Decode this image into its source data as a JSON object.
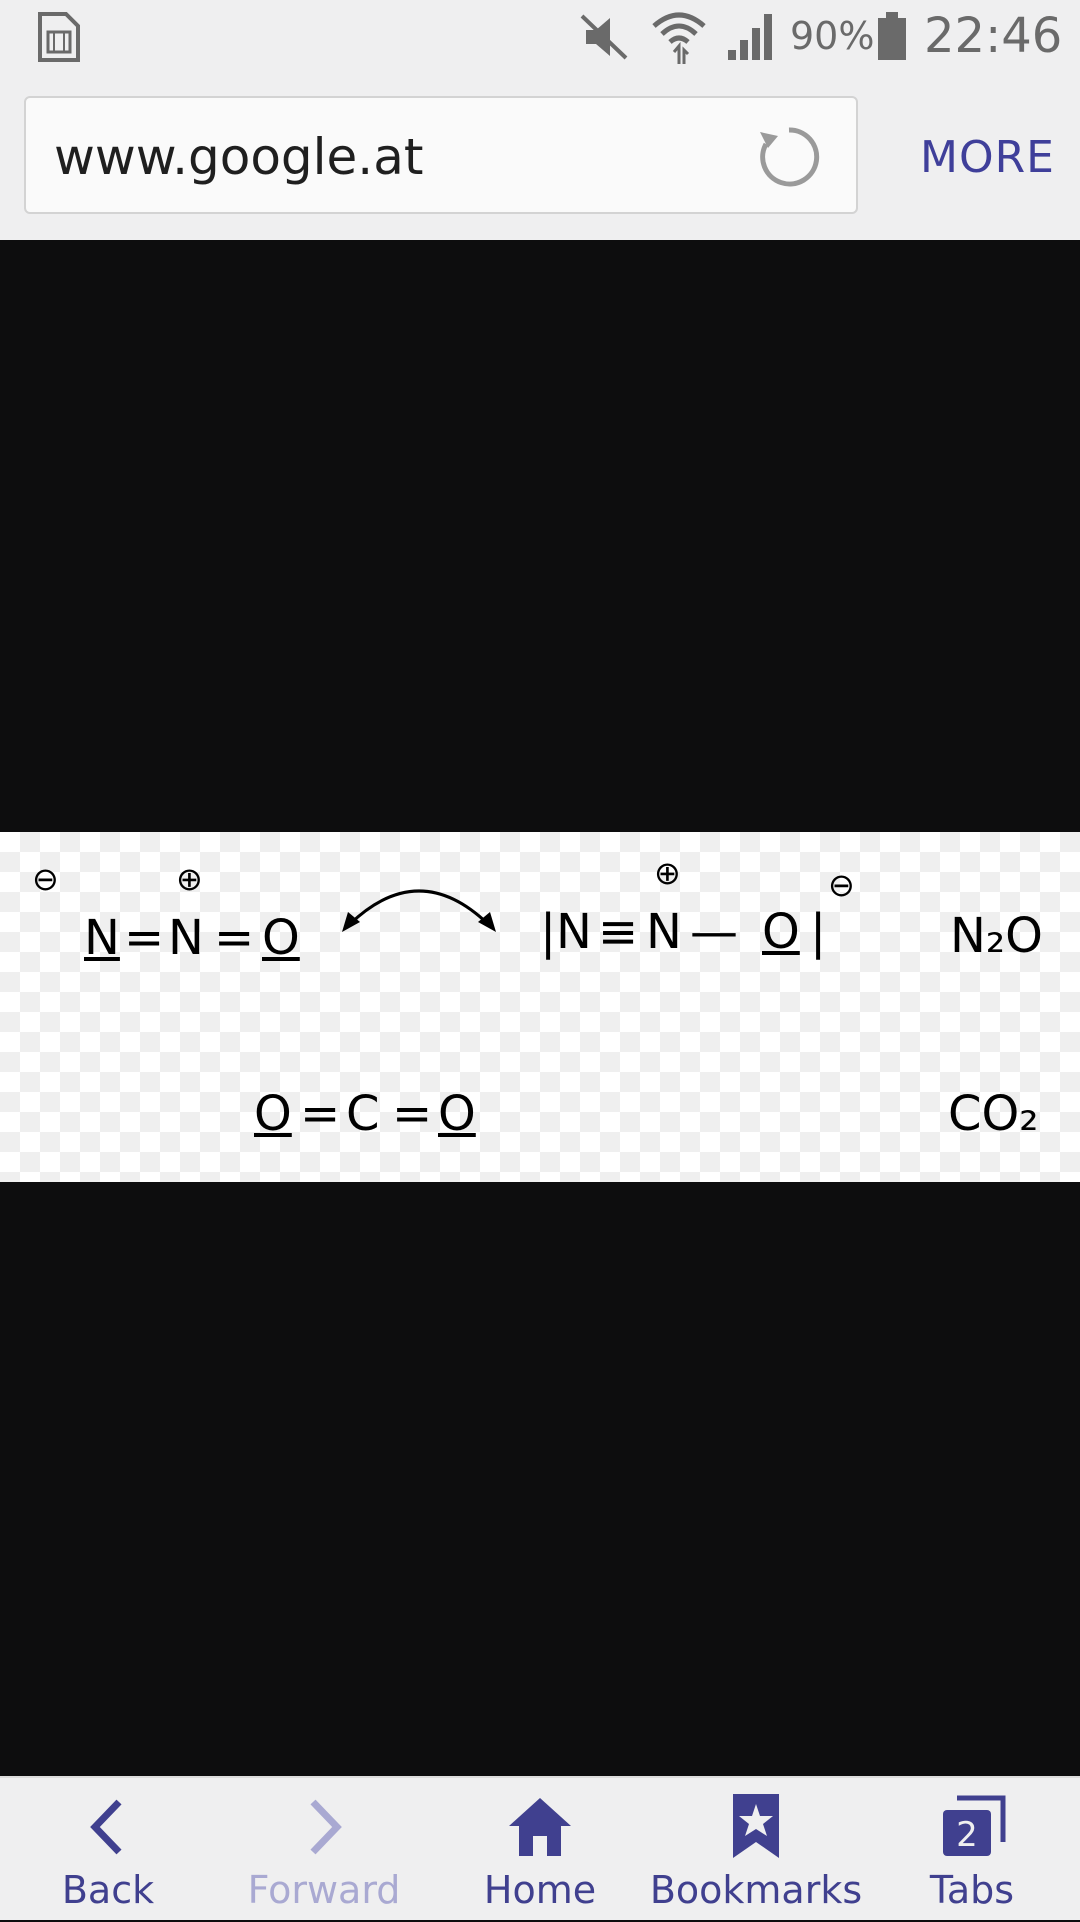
{
  "status_bar": {
    "battery_percent": "90%",
    "time": "22:46",
    "icons": [
      "sim-card-icon",
      "mute-icon",
      "wifi-icon",
      "signal-icon",
      "battery-icon"
    ]
  },
  "address_bar": {
    "url": "www.google.at",
    "more_label": "MORE"
  },
  "diagram": {
    "row1_left": {
      "n1": "N",
      "n2": "N",
      "o": "O",
      "bond1": "=",
      "bond2": "="
    },
    "row1_right": {
      "lead": "|",
      "n1": "N",
      "triple": "≡",
      "n2": "N",
      "single": "—",
      "o": "O",
      "trail": "|"
    },
    "row1_label": "N₂O",
    "row2": {
      "o1": "O",
      "c": "C",
      "o2": "O",
      "bond1": "=",
      "bond2": "="
    },
    "row2_label": "CO₂",
    "charges": {
      "minus": "⊖",
      "plus": "⊕"
    }
  },
  "bottom_nav": {
    "items": [
      {
        "label": "Back",
        "icon": "back-icon",
        "enabled": true
      },
      {
        "label": "Forward",
        "icon": "forward-icon",
        "enabled": false
      },
      {
        "label": "Home",
        "icon": "home-icon",
        "enabled": true
      },
      {
        "label": "Bookmarks",
        "icon": "bookmark-icon",
        "enabled": true
      },
      {
        "label": "Tabs",
        "icon": "tabs-icon",
        "enabled": true,
        "badge": "2"
      }
    ]
  },
  "colors": {
    "accent": "#40408f",
    "disabled": "#a9a9d2",
    "bar_bg": "#efeff0",
    "content_bg": "#0d0d0e"
  }
}
